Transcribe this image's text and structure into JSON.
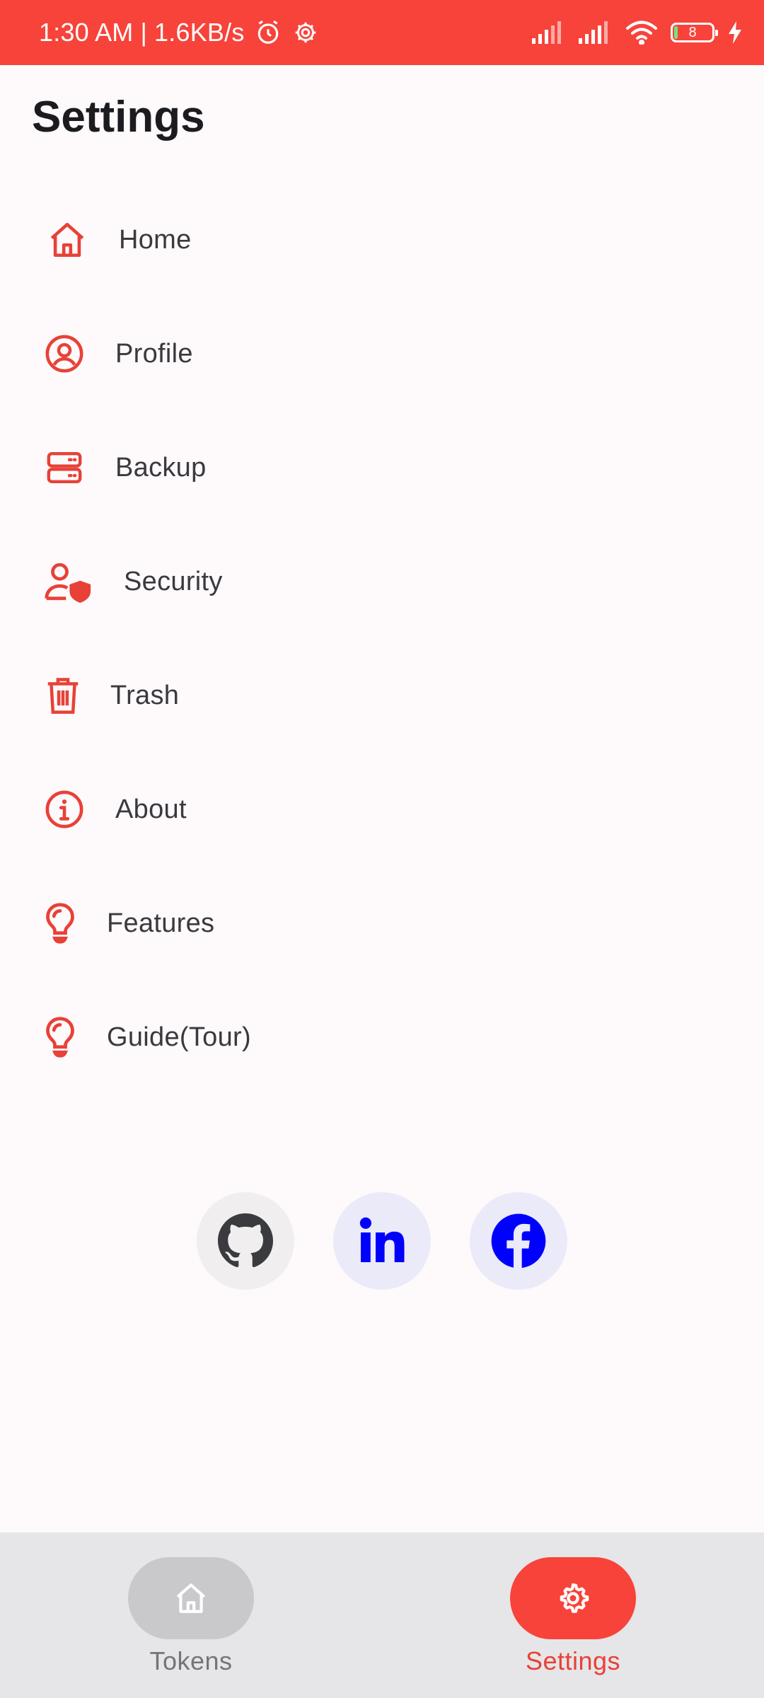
{
  "status_bar": {
    "time": "1:30 AM",
    "separator": "|",
    "network_speed": "1.6KB/s",
    "battery_level": "8",
    "icons": [
      "alarm-icon",
      "settings-gear-icon",
      "signal-icon",
      "signal-icon",
      "wifi-icon",
      "battery-icon",
      "charging-icon"
    ]
  },
  "page": {
    "title": "Settings"
  },
  "menu": {
    "items": [
      {
        "label": "Home",
        "icon": "home-icon"
      },
      {
        "label": "Profile",
        "icon": "profile-icon"
      },
      {
        "label": "Backup",
        "icon": "backup-server-icon"
      },
      {
        "label": "Security",
        "icon": "user-shield-icon"
      },
      {
        "label": "Trash",
        "icon": "trash-icon"
      },
      {
        "label": "About",
        "icon": "info-icon"
      },
      {
        "label": "Features",
        "icon": "lightbulb-icon"
      },
      {
        "label": "Guide(Tour)",
        "icon": "lightbulb-icon"
      }
    ]
  },
  "social": {
    "links": [
      {
        "icon": "github-icon"
      },
      {
        "icon": "linkedin-icon"
      },
      {
        "icon": "facebook-icon"
      }
    ]
  },
  "bottom_nav": {
    "items": [
      {
        "label": "Tokens",
        "icon": "home-icon",
        "active": false
      },
      {
        "label": "Settings",
        "icon": "gear-icon",
        "active": true
      }
    ]
  },
  "colors": {
    "accent": "#F7433A",
    "icon_red": "#E84137",
    "background": "#FEF9FB",
    "nav_background": "#E6E5E7",
    "inactive_pill": "#C9C8CA",
    "social_blue": "#0000FF"
  }
}
